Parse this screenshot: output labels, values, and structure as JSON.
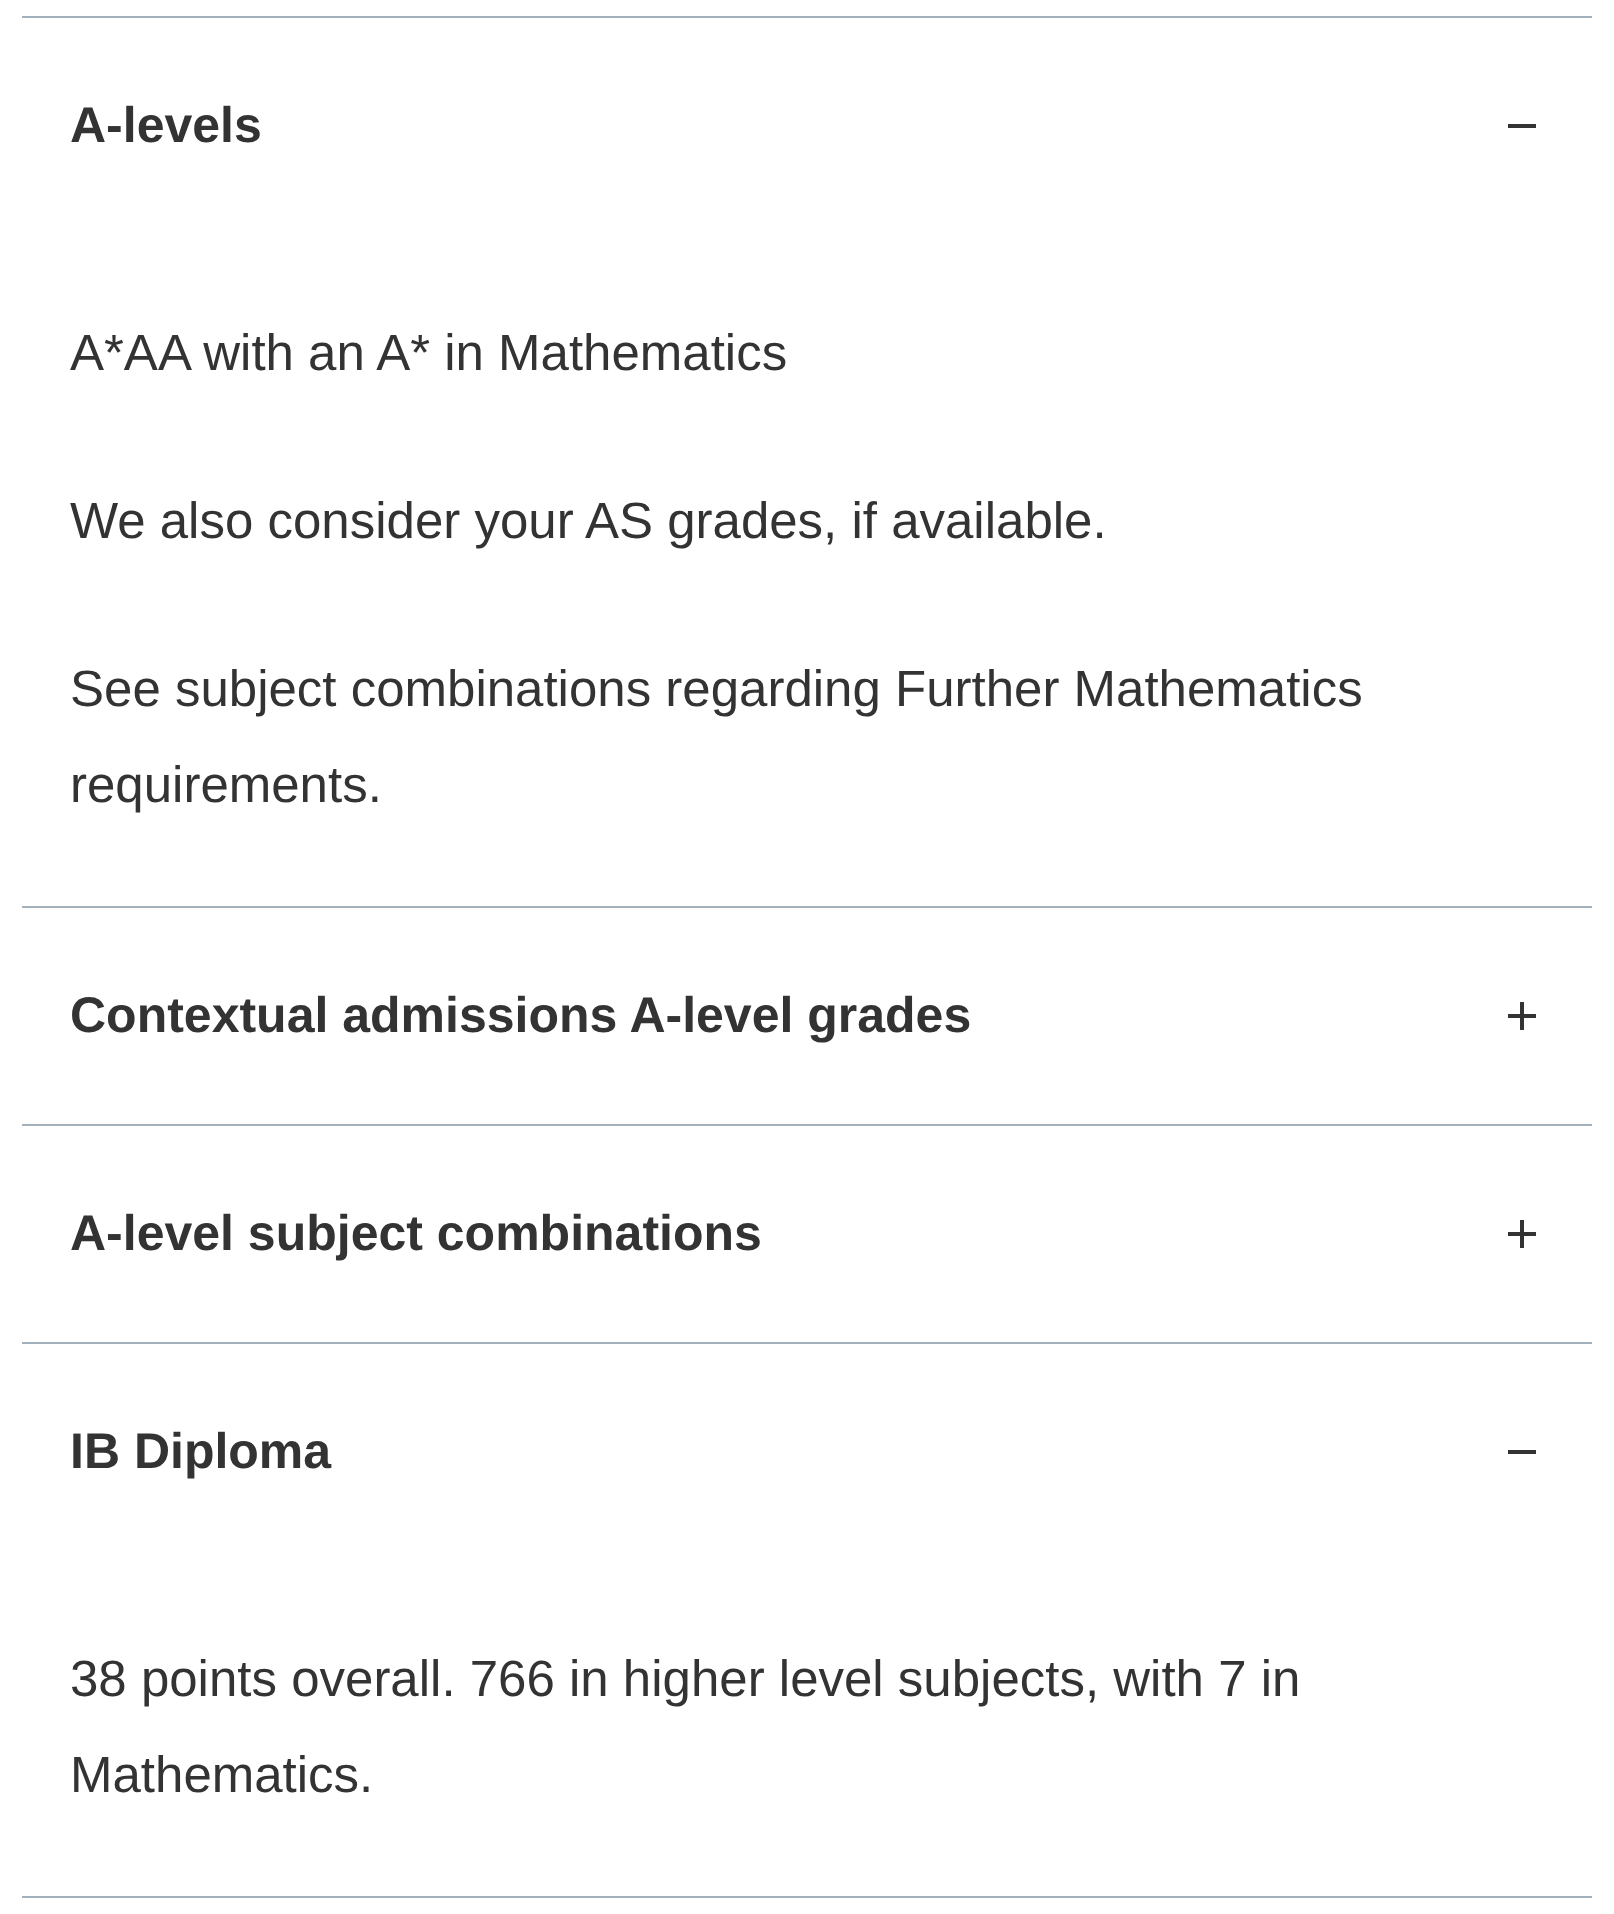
{
  "sections": [
    {
      "title": "A-levels",
      "expanded": true,
      "paragraphs": [
        "A*AA with an A* in Mathematics",
        "We also consider your AS grades, if available.",
        "See subject combinations regarding Further Mathematics requirements."
      ]
    },
    {
      "title": "Contextual admissions A-level grades",
      "expanded": false
    },
    {
      "title": "A-level subject combinations",
      "expanded": false
    },
    {
      "title": "IB Diploma",
      "expanded": true,
      "paragraphs": [
        "38 points overall. 766 in higher level subjects, with 7 in Mathematics."
      ]
    }
  ]
}
